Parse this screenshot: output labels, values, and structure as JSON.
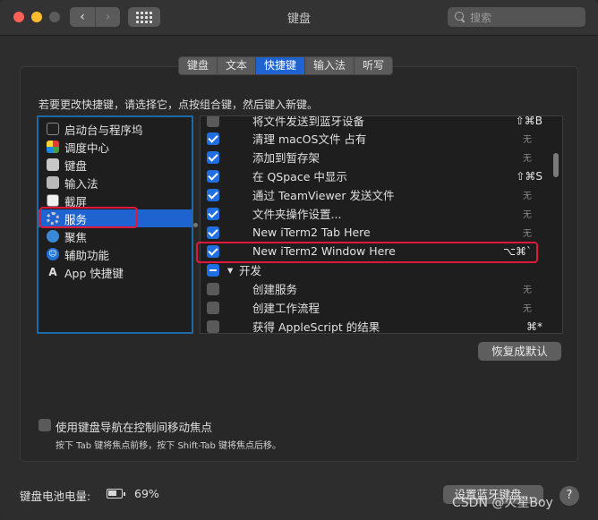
{
  "window": {
    "title": "键盘",
    "search_placeholder": "搜索"
  },
  "nav": {
    "back": "‹",
    "forward": "›"
  },
  "tabs": [
    {
      "label": "键盘",
      "active": false
    },
    {
      "label": "文本",
      "active": false
    },
    {
      "label": "快捷键",
      "active": true
    },
    {
      "label": "输入法",
      "active": false
    },
    {
      "label": "听写",
      "active": false
    }
  ],
  "instructions": "若要更改快捷键，请选择它，点按组合键，然后键入新键。",
  "categories": [
    {
      "label": "启动台与程序坞",
      "icon": "launchpad-icon"
    },
    {
      "label": "调度中心",
      "icon": "mission-control-icon"
    },
    {
      "label": "键盘",
      "icon": "keyboard-icon"
    },
    {
      "label": "输入法",
      "icon": "input-source-icon"
    },
    {
      "label": "截屏",
      "icon": "screenshot-icon"
    },
    {
      "label": "服务",
      "icon": "gear-icon",
      "selected": true
    },
    {
      "label": "聚焦",
      "icon": "spotlight-icon"
    },
    {
      "label": "辅助功能",
      "icon": "accessibility-icon"
    },
    {
      "label": "App 快捷键",
      "icon": "app-shortcuts-icon"
    }
  ],
  "shortcuts": [
    {
      "label": "将文件发送到蓝牙设备",
      "key": "⇧⌘B",
      "checked": false
    },
    {
      "label": "清理 macOS文件 占有",
      "key": "无",
      "checked": true
    },
    {
      "label": "添加到暂存架",
      "key": "无",
      "checked": true
    },
    {
      "label": "在 QSpace 中显示",
      "key": "⇧⌘S",
      "checked": true
    },
    {
      "label": "通过 TeamViewer 发送文件",
      "key": "无",
      "checked": true
    },
    {
      "label": "文件夹操作设置...",
      "key": "无",
      "checked": true
    },
    {
      "label": "New iTerm2 Tab Here",
      "key": "无",
      "checked": true
    },
    {
      "label": "New iTerm2 Window Here",
      "key": "⌥⌘`",
      "checked": true
    },
    {
      "label": "开发",
      "key": "",
      "checked": "mixed",
      "group": true
    },
    {
      "label": "创建服务",
      "key": "无",
      "checked": false
    },
    {
      "label": "创建工作流程",
      "key": "无",
      "checked": false
    },
    {
      "label": "获得 AppleScript 的结果",
      "key": "⌘*",
      "checked": false
    }
  ],
  "restore_defaults": "恢复成默认",
  "keyboard_nav": {
    "label": "使用键盘导航在控制间移动焦点",
    "hint": "按下 Tab 键将焦点前移，按下 Shift-Tab 键将焦点后移。",
    "checked": false
  },
  "battery": {
    "label": "键盘电池电量:",
    "percent": "69%",
    "level": 0.69
  },
  "bluetooth_button": "设置蓝牙键盘...",
  "help": "?",
  "watermark": "CSDN @火星Boy"
}
